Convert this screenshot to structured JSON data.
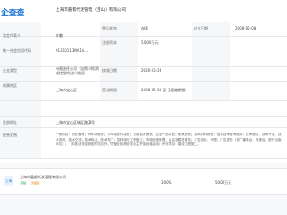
{
  "logo": "企查查",
  "company_name": "上海市嘉都代发管理（宝山）有限公司",
  "rows": {
    "legal_rep_label": "法定代表人",
    "legal_rep_value": "叶敬",
    "reg_status_label": "登记状态",
    "reg_status_value": "存续",
    "established_label": "成立日期",
    "established_value": "2008-05-08",
    "reg_capital_label": "注册资本",
    "reg_capital_value": "5,000万元",
    "credit_code_label": "统一社会信用代码",
    "credit_code_value": "91310113MA1G...",
    "company_type_label": "企业类型",
    "company_type_value": "有限责任公司（自然人投资或控股的法人独资）",
    "approval_label": "核准日期",
    "approval_value": "2020-03-26",
    "region_label": "所属地区",
    "region_value": "上海市宝山区",
    "business_term_label": "营业期限",
    "business_term_value": "2008-05-08 至 无固定期限",
    "address_label": "注册地址",
    "address_value": "上海市宝山区城区路某号",
    "scope_label": "经营范围"
  },
  "scope_text": "一般项目：物业管理；停车场服务；汽车零配件零售；日用百货销售；五金产品零售；家具销售；建筑材料销售；信息技术咨询服务；技术服务、技术开发、技术咨询、技术交流、技术转让、技术推广；园林绿化工程施工；市政设施管理；会议及展览服务；广告设计、代理；广告发布（非广播电台、电视台、报刊出版单位）；（除依法须经批准的项目外，凭营业执照依法自主开展经营活动）许可项目：建设工程施工。",
  "shareholder": {
    "avatar_text": "上海",
    "name": "上海市嘉都代发管理有限公司",
    "tag1": "存续",
    "tag2": "大股东",
    "percent": "100%",
    "amount": "5000万元"
  }
}
